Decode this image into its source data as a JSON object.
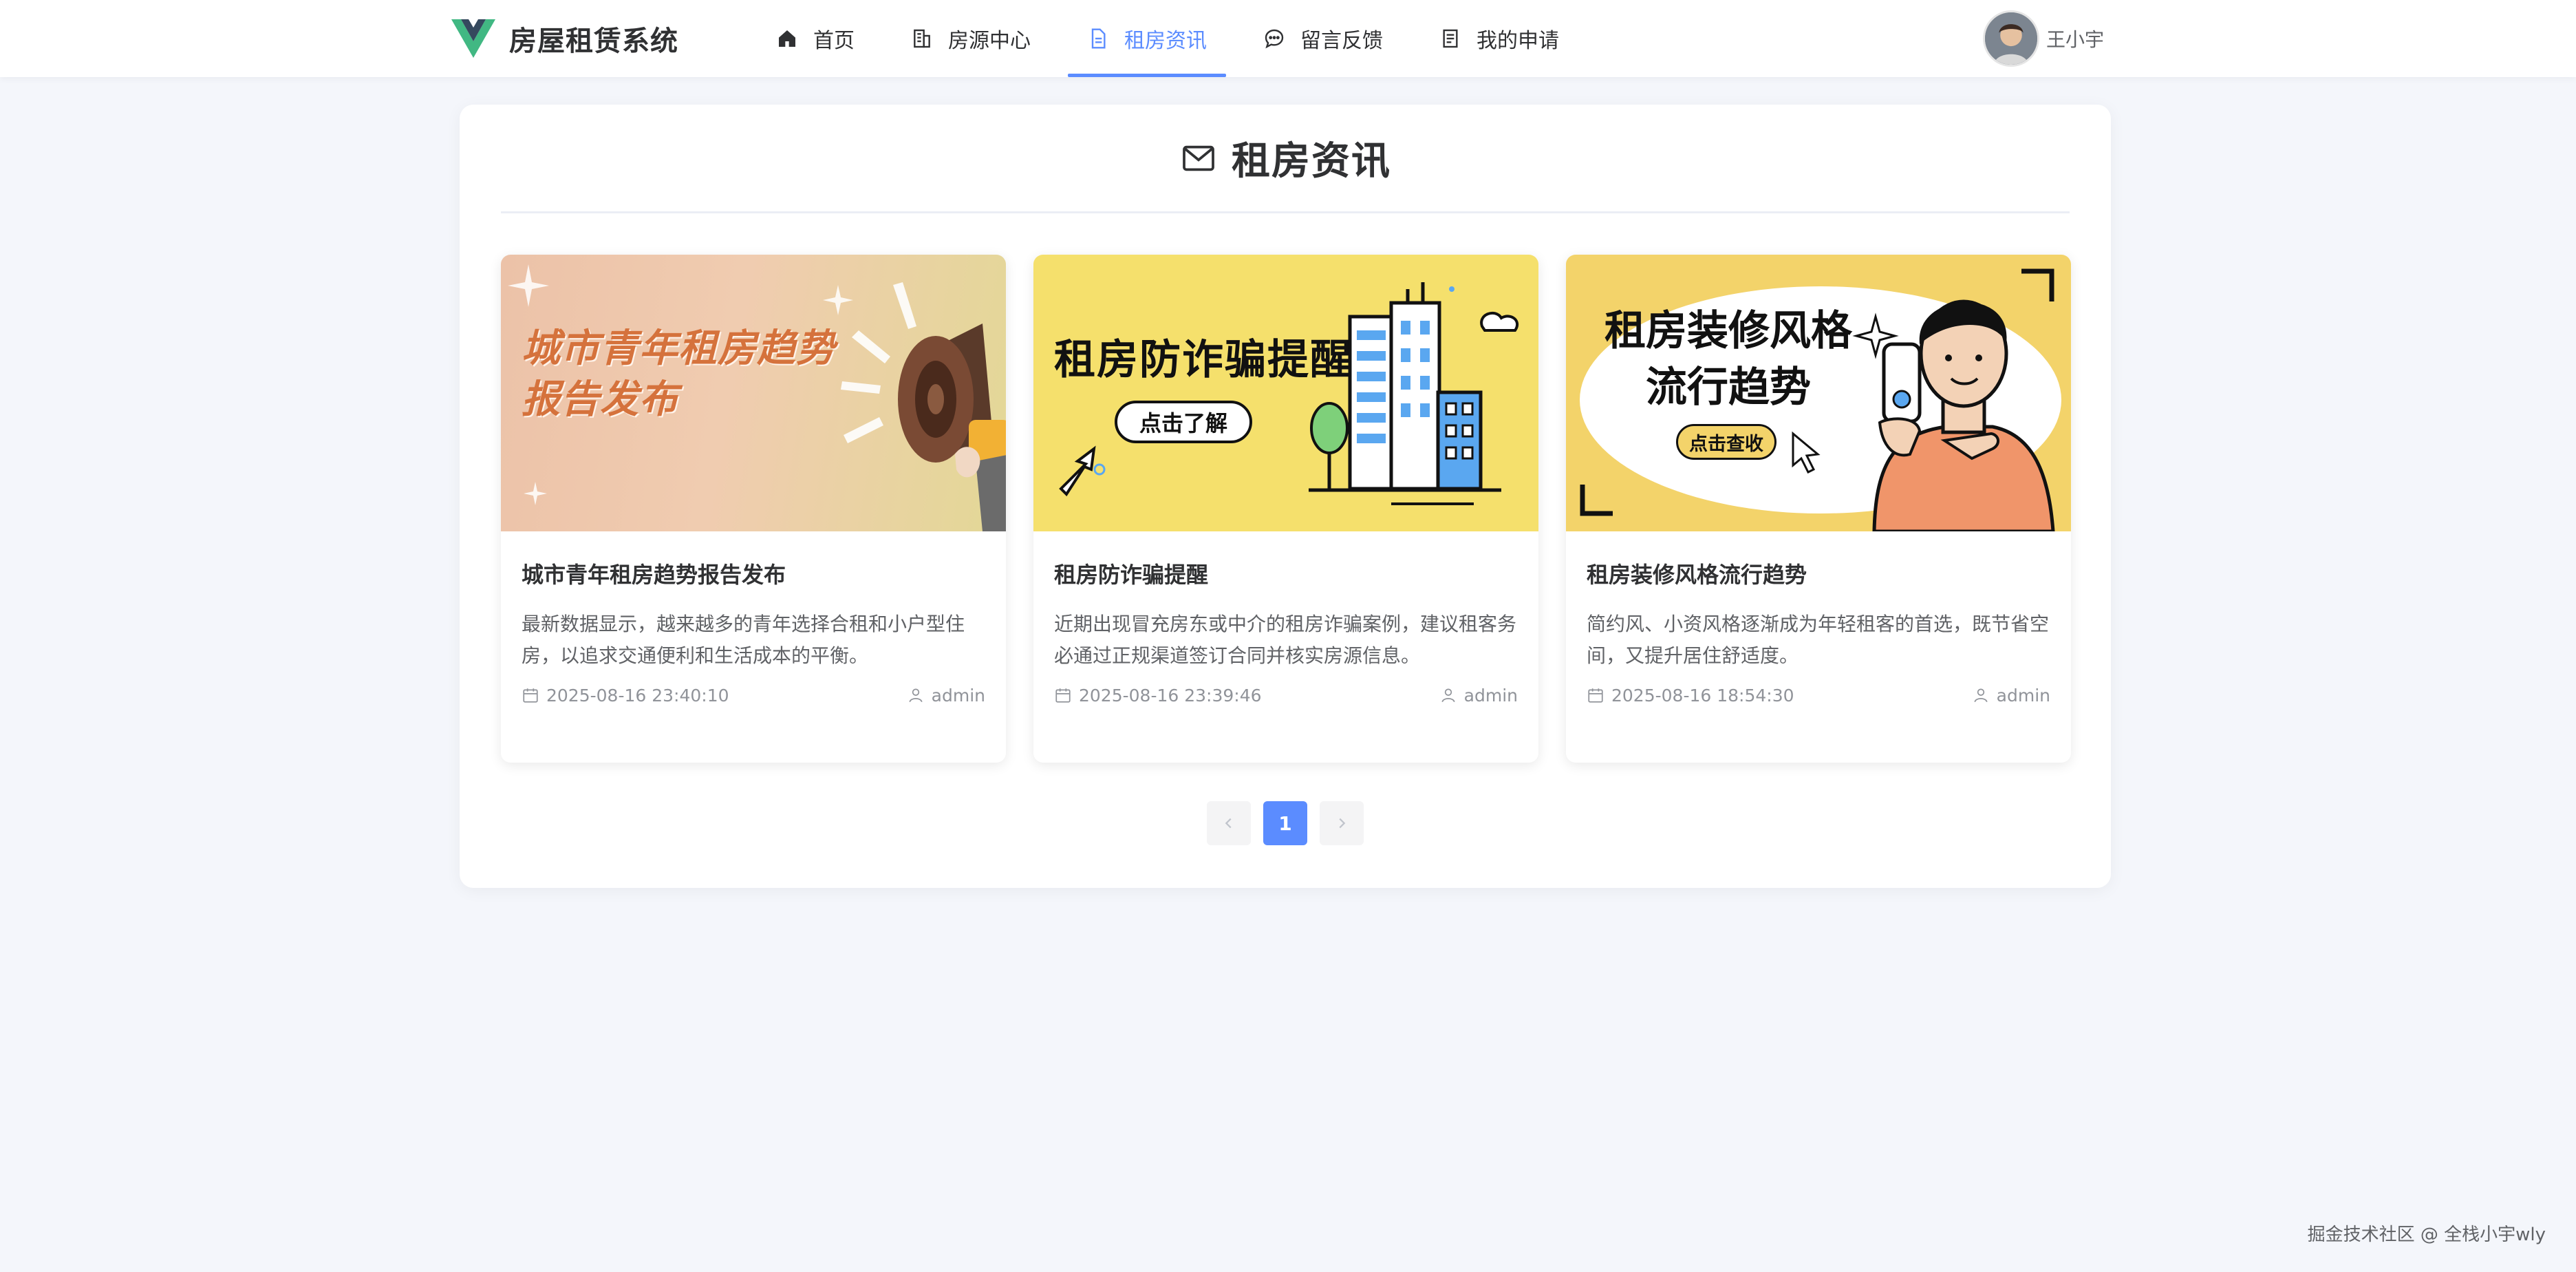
{
  "brand": {
    "title": "房屋租赁系统"
  },
  "nav": {
    "items": [
      {
        "label": "首页",
        "icon": "home-icon",
        "active": false
      },
      {
        "label": "房源中心",
        "icon": "building-icon",
        "active": false
      },
      {
        "label": "租房资讯",
        "icon": "document-icon",
        "active": true
      },
      {
        "label": "留言反馈",
        "icon": "chat-bubble-icon",
        "active": false
      },
      {
        "label": "我的申请",
        "icon": "list-document-icon",
        "active": false
      }
    ]
  },
  "user": {
    "name": "王小宇"
  },
  "page": {
    "title": "租房资讯"
  },
  "news": [
    {
      "cover_text": "城市青年租房趋势报告发布",
      "title": "城市青年租房趋势报告发布",
      "desc": "最新数据显示，越来越多的青年选择合租和小户型住房，以追求交通便利和生活成本的平衡。",
      "date": "2025-08-16 23:40:10",
      "author": "admin"
    },
    {
      "cover_text": "租房防诈骗提醒",
      "cover_button": "点击了解",
      "title": "租房防诈骗提醒",
      "desc": "近期出现冒充房东或中介的租房诈骗案例，建议租客务必通过正规渠道签订合同并核实房源信息。",
      "date": "2025-08-16 23:39:46",
      "author": "admin"
    },
    {
      "cover_text": "租房装修风格流行趋势",
      "cover_button": "点击查收",
      "title": "租房装修风格流行趋势",
      "desc": "简约风、小资风格逐渐成为年轻租客的首选，既节省空间，又提升居住舒适度。",
      "date": "2025-08-16 18:54:30",
      "author": "admin"
    }
  ],
  "pagination": {
    "current": "1",
    "prev_icon": "chevron-left-icon",
    "next_icon": "chevron-right-icon"
  },
  "footer": {
    "watermark": "掘金技术社区 @ 全栈小宇wly"
  },
  "colors": {
    "accent": "#5b8cff",
    "background": "#f4f6fb"
  }
}
